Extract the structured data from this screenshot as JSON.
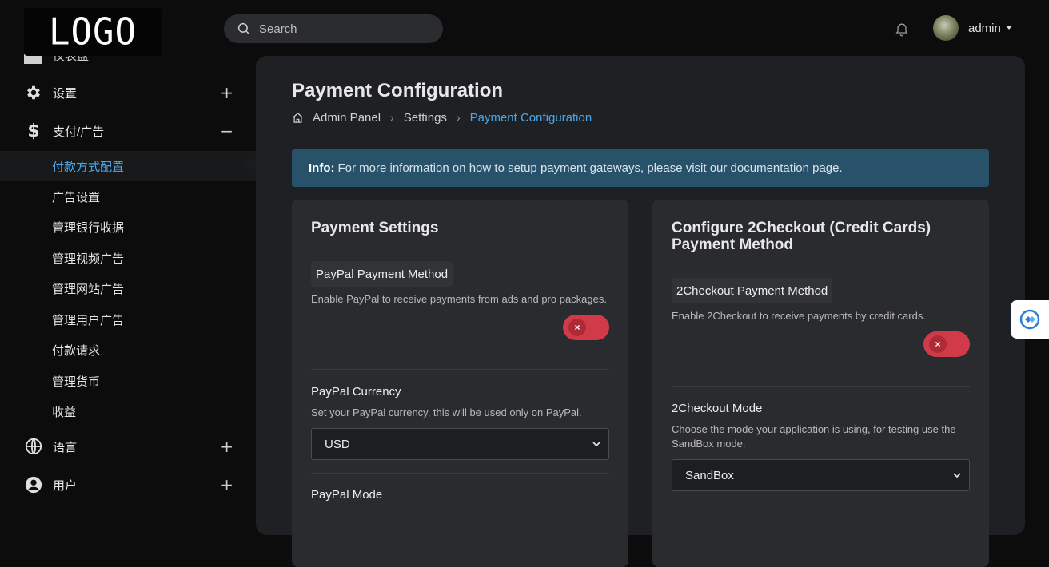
{
  "brand": {
    "logo_text": "LOGO"
  },
  "sidebar": {
    "hidden_item_label": "仪表盘",
    "items": [
      {
        "label": "设置",
        "icon": "gear-icon",
        "toggle": "+"
      },
      {
        "label": "支付/广告",
        "icon": "dollar-icon",
        "toggle": "−"
      },
      {
        "label": "语言",
        "icon": "globe-icon",
        "toggle": "+"
      },
      {
        "label": "用户",
        "icon": "user-circle-icon",
        "toggle": "+"
      }
    ],
    "sub_items": [
      "付款方式配置",
      "广告设置",
      "管理银行收据",
      "管理视频广告",
      "管理网站广告",
      "管理用户广告",
      "付款请求",
      "管理货币",
      "收益"
    ]
  },
  "header": {
    "search_placeholder": "Search",
    "user_name": "admin"
  },
  "page": {
    "title": "Payment Configuration",
    "breadcrumb": [
      "Admin Panel",
      "Settings",
      "Payment Configuration"
    ],
    "info_label": "Info:",
    "info_text": "For more information on how to setup payment gateways, please visit our documentation page."
  },
  "payment_settings": {
    "title": "Payment Settings",
    "paypal_method_label": "PayPal Payment Method",
    "paypal_method_help": "Enable PayPal to receive payments from ads and pro packages.",
    "paypal_enabled": false,
    "currency_label": "PayPal Currency",
    "currency_help": "Set your PayPal currency, this will be used only on PayPal.",
    "currency_value": "USD",
    "mode_label": "PayPal Mode"
  },
  "checkout": {
    "title": "Configure 2Checkout (Credit Cards) Payment Method",
    "method_label": "2Checkout Payment Method",
    "method_help": "Enable 2Checkout to receive payments by credit cards.",
    "enabled": false,
    "mode_label": "2Checkout Mode",
    "mode_help": "Choose the mode your application is using, for testing use the SandBox mode.",
    "mode_value": "SandBox"
  },
  "colors": {
    "accent": "#4aa8e8",
    "toggle_off": "#d13a48",
    "info_bg": "#27526a"
  }
}
